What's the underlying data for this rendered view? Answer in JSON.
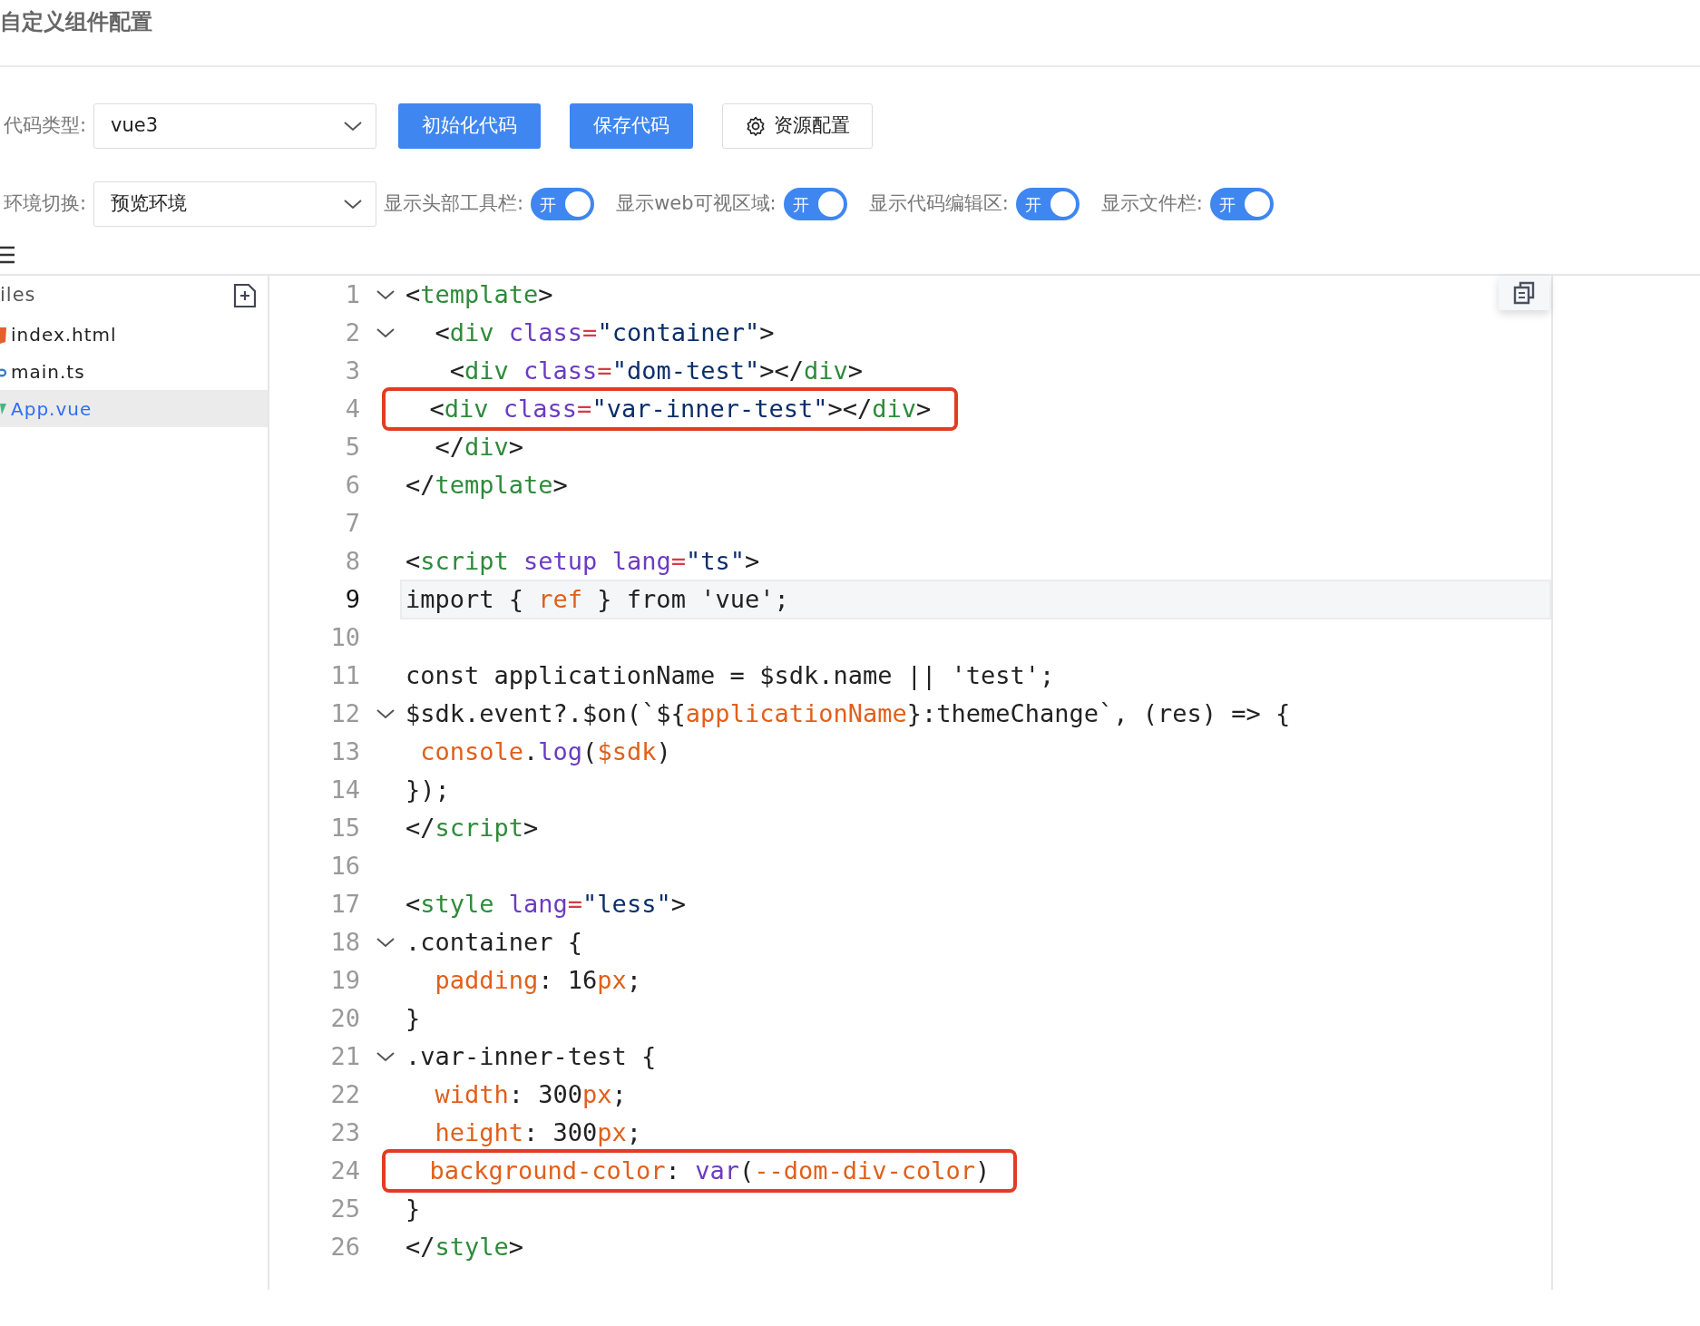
{
  "title": "自定义组件配置",
  "toolbar": {
    "code_type": {
      "label": "代码类型:",
      "value": "vue3"
    },
    "buttons": [
      {
        "label": "初始化代码",
        "kind": "primary"
      },
      {
        "label": "保存代码",
        "kind": "primary"
      },
      {
        "label": "资源配置",
        "kind": "settings"
      }
    ],
    "env": {
      "label": "环境切换:",
      "value": "预览环境"
    },
    "toggles": [
      {
        "label": "显示头部工具栏:",
        "text": "开",
        "on": true
      },
      {
        "label": "显示web可视区域:",
        "text": "开",
        "on": true
      },
      {
        "label": "显示代码编辑区:",
        "text": "开",
        "on": true
      },
      {
        "label": "显示文件栏:",
        "text": "开",
        "on": true
      }
    ]
  },
  "sidebar": {
    "header": "iles",
    "files": [
      {
        "name": "index.html",
        "selected": false
      },
      {
        "name": "main.ts",
        "selected": false
      },
      {
        "name": "App.vue",
        "selected": true
      }
    ]
  },
  "editor": {
    "lines": [
      {
        "no": "1",
        "fold": true,
        "active": false,
        "highlighted": false,
        "text": "<template>"
      },
      {
        "no": "2",
        "fold": true,
        "active": false,
        "highlighted": false,
        "text": "  <div class=\"container\">"
      },
      {
        "no": "3",
        "fold": false,
        "active": false,
        "highlighted": false,
        "text": "   <div class=\"dom-test\"></div>"
      },
      {
        "no": "4",
        "fold": false,
        "active": false,
        "highlighted": true,
        "text": "  <div class=\"var-inner-test\"></div>"
      },
      {
        "no": "5",
        "fold": false,
        "active": false,
        "highlighted": false,
        "text": "  </div>"
      },
      {
        "no": "6",
        "fold": false,
        "active": false,
        "highlighted": false,
        "text": "</template>"
      },
      {
        "no": "7",
        "fold": false,
        "active": false,
        "highlighted": false
      },
      {
        "no": "8",
        "fold": false,
        "active": false,
        "highlighted": false,
        "text": "<script setup lang=\"ts\">"
      },
      {
        "no": "9",
        "fold": false,
        "active": true,
        "highlighted": false,
        "text": "import { ref } from 'vue';"
      },
      {
        "no": "10",
        "fold": false,
        "active": false,
        "highlighted": false
      },
      {
        "no": "11",
        "fold": false,
        "active": false,
        "highlighted": false,
        "text": "const applicationName = $sdk.name || 'test';"
      },
      {
        "no": "12",
        "fold": true,
        "active": false,
        "highlighted": false,
        "text": "$sdk.event?.$on(`${applicationName}:themeChange`, (res) => {"
      },
      {
        "no": "13",
        "fold": false,
        "active": false,
        "highlighted": false,
        "text": " console.log($sdk)"
      },
      {
        "no": "14",
        "fold": false,
        "active": false,
        "highlighted": false,
        "text": "});"
      },
      {
        "no": "15",
        "fold": false,
        "active": false,
        "highlighted": false,
        "text": "</script>"
      },
      {
        "no": "16",
        "fold": false,
        "active": false,
        "highlighted": false
      },
      {
        "no": "17",
        "fold": false,
        "active": false,
        "highlighted": false,
        "text": "<style lang=\"less\">"
      },
      {
        "no": "18",
        "fold": true,
        "active": false,
        "highlighted": false,
        "text": ".container {"
      },
      {
        "no": "19",
        "fold": false,
        "active": false,
        "highlighted": false,
        "text": "  padding: 16px;"
      },
      {
        "no": "20",
        "fold": false,
        "active": false,
        "highlighted": false,
        "text": "}"
      },
      {
        "no": "21",
        "fold": true,
        "active": false,
        "highlighted": false,
        "text": ".var-inner-test {"
      },
      {
        "no": "22",
        "fold": false,
        "active": false,
        "highlighted": false,
        "text": "  width: 300px;"
      },
      {
        "no": "23",
        "fold": false,
        "active": false,
        "highlighted": false,
        "text": "  height: 300px;"
      },
      {
        "no": "24",
        "fold": false,
        "active": false,
        "highlighted": true,
        "text": "  background-color: var(--dom-div-color)"
      },
      {
        "no": "25",
        "fold": false,
        "active": false,
        "highlighted": false,
        "text": "}"
      },
      {
        "no": "26",
        "fold": false,
        "active": false,
        "highlighted": false,
        "text": "</style>"
      }
    ]
  }
}
